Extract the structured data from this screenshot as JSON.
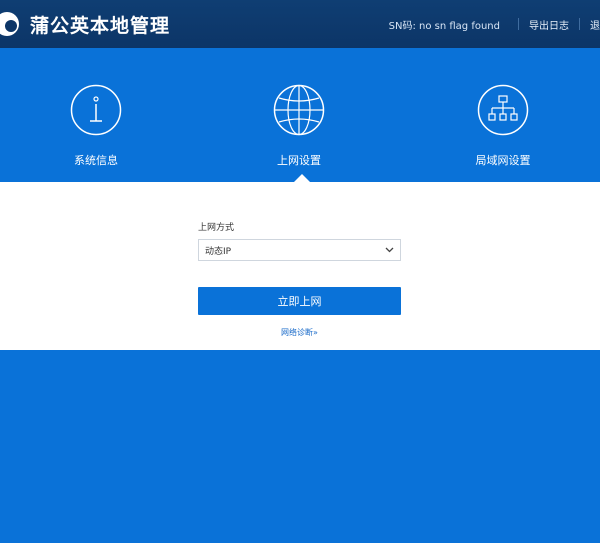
{
  "header": {
    "title": "蒲公英本地管理",
    "sn_text": "SN码: no sn flag found",
    "export_log": "导出日志",
    "logout": "退出"
  },
  "tabs": [
    {
      "label": "系统信息",
      "icon": "info-icon"
    },
    {
      "label": "上网设置",
      "icon": "globe-icon",
      "active": true
    },
    {
      "label": "局域网设置",
      "icon": "network-icon"
    }
  ],
  "form": {
    "mode_label": "上网方式",
    "mode_value": "动态IP",
    "connect_button": "立即上网",
    "diagnose_link": "网络诊断»"
  },
  "colors": {
    "header_bg": "#0c3567",
    "primary_blue": "#0a72d8",
    "content_bg": "#ffffff",
    "link_blue": "#1668c8"
  }
}
